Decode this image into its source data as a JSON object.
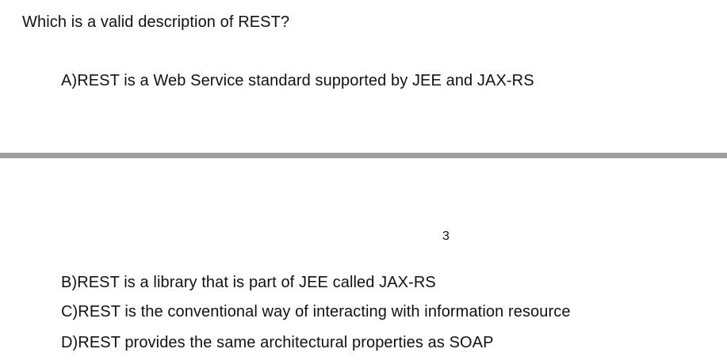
{
  "question": "Which is a valid description of REST?",
  "options": [
    "A)REST is a Web Service standard supported by JEE and JAX-RS",
    "B)REST is a library that is part of JEE called JAX-RS",
    "C)REST is the conventional way of interacting with information resource",
    "D)REST provides the same architectural properties as SOAP"
  ],
  "page_number": "3"
}
